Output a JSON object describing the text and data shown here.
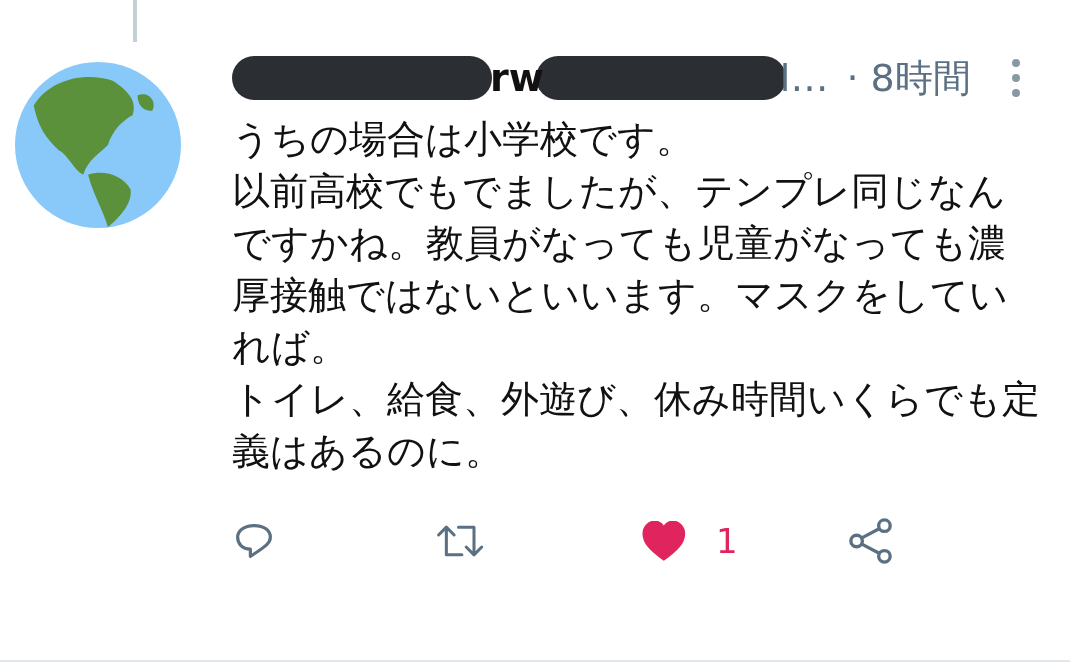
{
  "tweet": {
    "name_fragment": "rw",
    "handle_fragment": "l…",
    "time": "· 8時間",
    "paragraphs": [
      "うちの場合は小学校です。",
      "以前高校でもでましたが、テンプレ同じなんですかね。教員がなっても児童がなっても濃厚接触ではないといいます。マスクをしていれば。",
      "トイレ、給食、外遊び、休み時間いくらでも定義はあるのに。"
    ],
    "like_count": "1",
    "liked": true
  }
}
